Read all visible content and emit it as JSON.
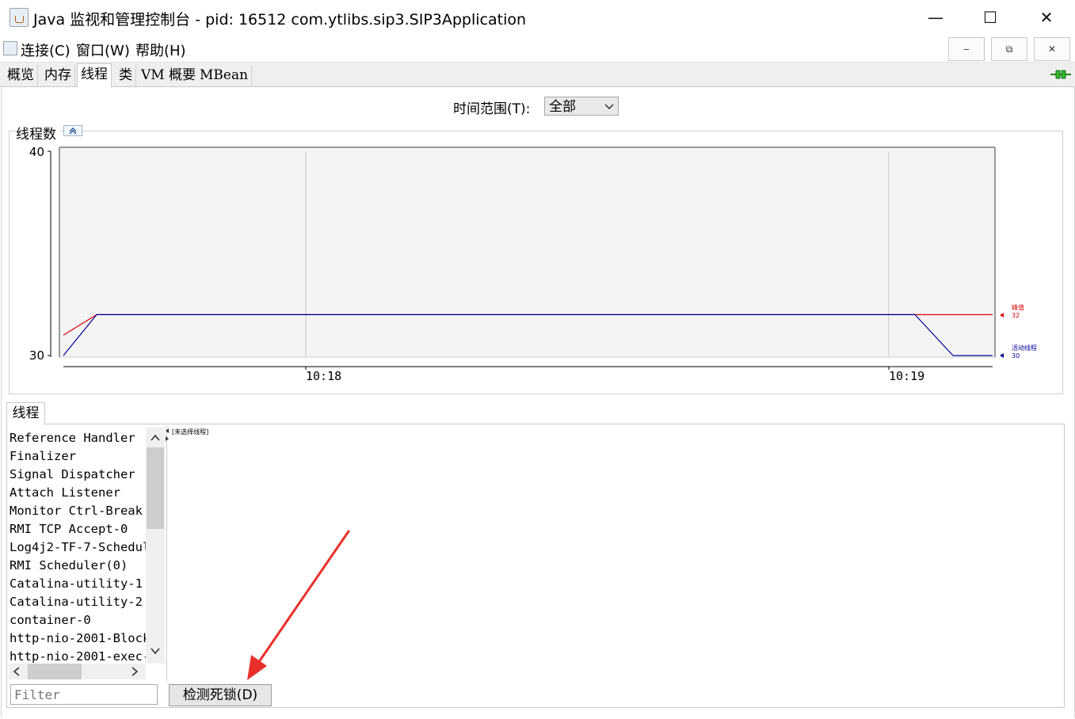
{
  "window": {
    "title": "Java 监视和管理控制台 - pid: 16512 com.ytlibs.sip3.SIP3Application",
    "minimize": "—",
    "maximize": "☐",
    "close": "✕"
  },
  "menu": {
    "items": [
      "连接(C)",
      "窗口(W)",
      "帮助(H)"
    ],
    "mdi_minimize": "‒",
    "mdi_restore": "⧉",
    "mdi_close": "✕"
  },
  "tabs": [
    "概览",
    "内存",
    "线程",
    "类",
    "VM 概要",
    "MBean"
  ],
  "active_tab": "线程",
  "time_range": {
    "label": "时间范围(T):",
    "selected": "全部"
  },
  "chart_data": {
    "type": "line",
    "title": "线程数",
    "y_ticks": [
      "40",
      "30"
    ],
    "ylim": [
      30,
      40
    ],
    "x_ticks": [
      "10:18",
      "10:19"
    ],
    "series": [
      {
        "name": "峰值",
        "color": "#e00000",
        "current_label": "32",
        "values": [
          31,
          32,
          32,
          32,
          32,
          32
        ]
      },
      {
        "name": "活动线程",
        "color": "#000099",
        "current_label": "30",
        "values": [
          30,
          32,
          32,
          32,
          30,
          30
        ]
      }
    ]
  },
  "threads": {
    "tab_label": "线程",
    "list": [
      "Reference Handler",
      "Finalizer",
      "Signal Dispatcher",
      "Attach Listener",
      "Monitor Ctrl-Break",
      "RMI TCP Accept-0",
      "Log4j2-TF-7-Schedul",
      "RMI Scheduler(0)",
      "Catalina-utility-1",
      "Catalina-utility-2",
      "container-0",
      "http-nio-2001-Block",
      "http-nio-2001-exec-"
    ],
    "detail": "[未选择线程]",
    "filter_placeholder": "Filter",
    "detect_deadlock": "检测死锁(D)"
  },
  "colors": {
    "peak": "#e00000",
    "live": "#000099",
    "annotation": "#e8302a"
  },
  "icons": [
    "java-icon",
    "connection-plug-icon",
    "collapse-icon",
    "dropdown-chevron-icon",
    "scroll-up-icon",
    "scroll-down-icon",
    "scroll-left-icon",
    "scroll-right-icon"
  ]
}
